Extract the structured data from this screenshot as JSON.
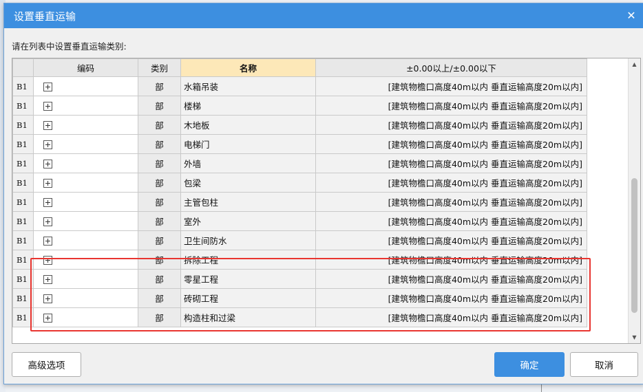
{
  "dialog": {
    "title": "设置垂直运输",
    "close_glyph": "✕",
    "instruction": "请在列表中设置垂直运输类别:"
  },
  "table": {
    "headers": {
      "code": "编码",
      "category": "类别",
      "name": "名称",
      "spec": "±0.00以上/±0.00以下"
    },
    "rows": [
      {
        "id": "B1",
        "category": "部",
        "name": "水箱吊装",
        "spec": "[建筑物檐口高度40m以内 垂直运输高度20m以内]"
      },
      {
        "id": "B1",
        "category": "部",
        "name": "楼梯",
        "spec": "[建筑物檐口高度40m以内 垂直运输高度20m以内]"
      },
      {
        "id": "B1",
        "category": "部",
        "name": "木地板",
        "spec": "[建筑物檐口高度40m以内 垂直运输高度20m以内]"
      },
      {
        "id": "B1",
        "category": "部",
        "name": "电梯门",
        "spec": "[建筑物檐口高度40m以内 垂直运输高度20m以内]"
      },
      {
        "id": "B1",
        "category": "部",
        "name": "外墙",
        "spec": "[建筑物檐口高度40m以内 垂直运输高度20m以内]"
      },
      {
        "id": "B1",
        "category": "部",
        "name": "包梁",
        "spec": "[建筑物檐口高度40m以内 垂直运输高度20m以内]"
      },
      {
        "id": "B1",
        "category": "部",
        "name": "主管包柱",
        "spec": "[建筑物檐口高度40m以内 垂直运输高度20m以内]"
      },
      {
        "id": "B1",
        "category": "部",
        "name": "室外",
        "spec": "[建筑物檐口高度40m以内 垂直运输高度20m以内]"
      },
      {
        "id": "B1",
        "category": "部",
        "name": "卫生间防水",
        "spec": "[建筑物檐口高度40m以内 垂直运输高度20m以内]"
      },
      {
        "id": "B1",
        "category": "部",
        "name": "拆除工程",
        "spec": "[建筑物檐口高度40m以内 垂直运输高度20m以内]"
      },
      {
        "id": "B1",
        "category": "部",
        "name": "零星工程",
        "spec": "[建筑物檐口高度40m以内 垂直运输高度20m以内]"
      },
      {
        "id": "B1",
        "category": "部",
        "name": "砖砌工程",
        "spec": "[建筑物檐口高度40m以内 垂直运输高度20m以内]"
      },
      {
        "id": "B1",
        "category": "部",
        "name": "构造柱和过梁",
        "spec": "[建筑物檐口高度40m以内 垂直运输高度20m以内]"
      }
    ]
  },
  "buttons": {
    "advanced": "高级选项",
    "ok": "确定",
    "cancel": "取消"
  },
  "scrollbar": {
    "up_glyph": "▲",
    "down_glyph": "▼"
  },
  "colors": {
    "title_bar": "#3d8fe0",
    "highlight_outline": "#e8342f",
    "name_header": "#fde8b8"
  }
}
